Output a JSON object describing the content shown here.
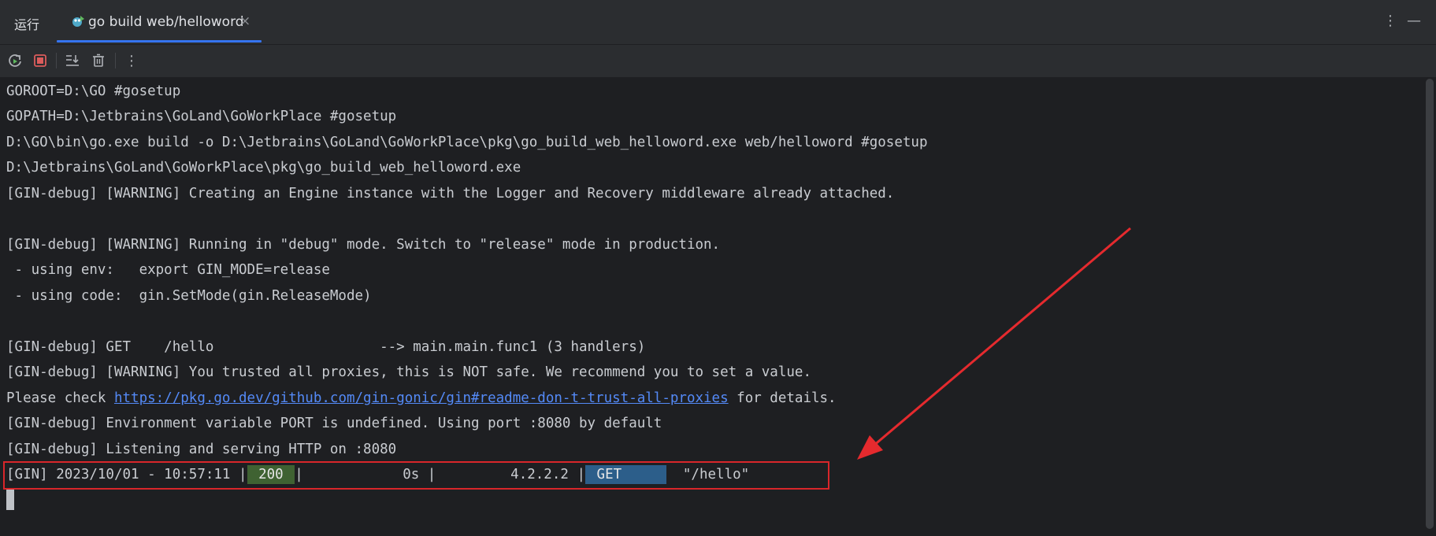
{
  "tabbar": {
    "run_label": "运行",
    "active_tab_label": "go build web/helloword",
    "close_glyph": "×",
    "more_glyph": "⋮",
    "minimize_glyph": "—"
  },
  "toolbar": {
    "buttons": [
      "rerun-icon",
      "stop-icon",
      "scroll-to-end-icon",
      "clear-all-icon",
      "more-icon"
    ],
    "more_glyph": "⋮"
  },
  "console": {
    "lines": [
      "GOROOT=D:\\GO #gosetup",
      "GOPATH=D:\\Jetbrains\\GoLand\\GoWorkPlace #gosetup",
      "D:\\GO\\bin\\go.exe build -o D:\\Jetbrains\\GoLand\\GoWorkPlace\\pkg\\go_build_web_helloword.exe web/helloword #gosetup",
      "D:\\Jetbrains\\GoLand\\GoWorkPlace\\pkg\\go_build_web_helloword.exe",
      "[GIN-debug] [WARNING] Creating an Engine instance with the Logger and Recovery middleware already attached.",
      "",
      "[GIN-debug] [WARNING] Running in \"debug\" mode. Switch to \"release\" mode in production.",
      " - using env:   export GIN_MODE=release",
      " - using code:  gin.SetMode(gin.ReleaseMode)",
      "",
      "[GIN-debug] GET    /hello                    --> main.main.func1 (3 handlers)",
      "[GIN-debug] [WARNING] You trusted all proxies, this is NOT safe. We recommend you to set a value.",
      "",
      "[GIN-debug] Environment variable PORT is undefined. Using port :8080 by default",
      "[GIN-debug] Listening and serving HTTP on :8080"
    ],
    "proxy_line": {
      "prefix": "Please check ",
      "link": "https://pkg.go.dev/github.com/gin-gonic/gin#readme-don-t-trust-all-proxies",
      "suffix": " for details."
    },
    "request_log": {
      "prefix": "[GIN] 2023/10/01 - 10:57:11 |",
      "status": " 200 ",
      "mid": "|            0s |         4.2.2.2 |",
      "method": " GET     ",
      "path": "  \"/hello\""
    }
  },
  "colors": {
    "background": "#1e1f22",
    "panel": "#2b2d30",
    "accent": "#3574f0",
    "link": "#548af7",
    "status_ok_bg": "#3f6232",
    "method_get_bg": "#2c5e8a",
    "annotation_red": "#d9262a"
  }
}
